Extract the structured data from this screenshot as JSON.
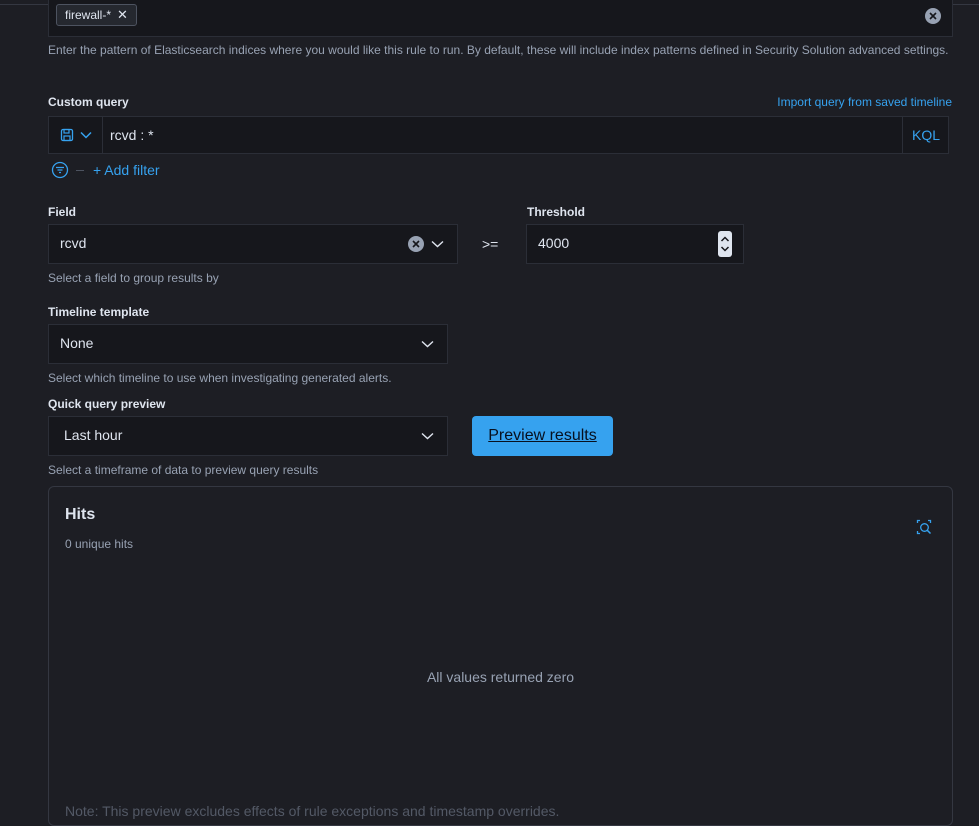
{
  "index_patterns": {
    "chip_label": "firewall-*",
    "help": "Enter the pattern of Elasticsearch indices where you would like this rule to run. By default, these will include index patterns defined in Security Solution advanced settings."
  },
  "custom_query": {
    "label": "Custom query",
    "import_link": "Import query from saved timeline",
    "value": "rcvd : *",
    "language": "KQL",
    "add_filter": "+ Add filter"
  },
  "field": {
    "label": "Field",
    "value": "rcvd",
    "help": "Select a field to group results by"
  },
  "operator": ">=",
  "threshold": {
    "label": "Threshold",
    "value": "4000"
  },
  "timeline_template": {
    "label": "Timeline template",
    "value": "None",
    "help": "Select which timeline to use when investigating generated alerts."
  },
  "quick_query_preview": {
    "label": "Quick query preview",
    "value": "Last hour",
    "help": "Select a timeframe of data to preview query results",
    "button": "Preview results"
  },
  "hits": {
    "title": "Hits",
    "subtitle": "0 unique hits",
    "empty_message": "All values returned zero",
    "note": "Note: This preview excludes effects of rule exceptions and timestamp overrides."
  },
  "colors": {
    "accent": "#36a2ef",
    "background": "#1d1e24",
    "input_background": "#16171c"
  }
}
